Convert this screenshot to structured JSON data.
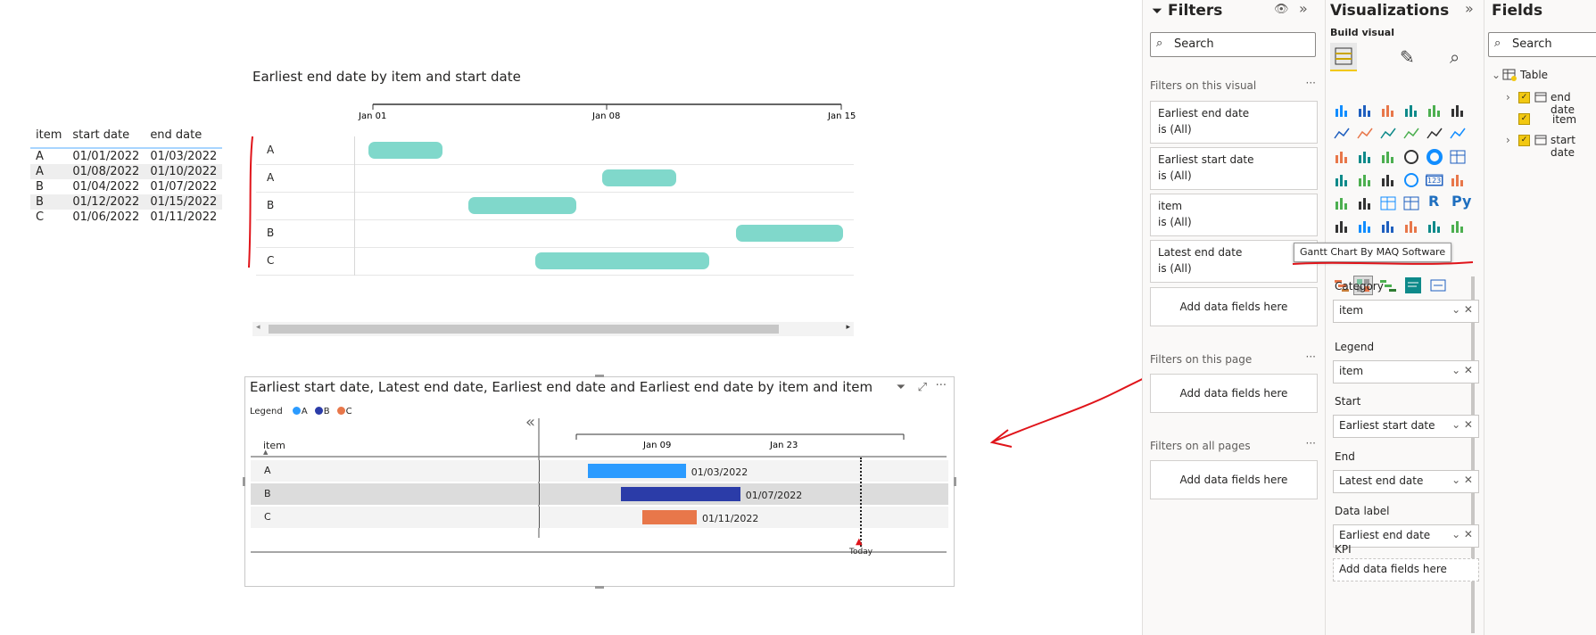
{
  "table": {
    "headers": [
      "item",
      "start date",
      "end date"
    ],
    "rows": [
      [
        "A",
        "01/01/2022",
        "01/03/2022"
      ],
      [
        "A",
        "01/08/2022",
        "01/10/2022"
      ],
      [
        "B",
        "01/04/2022",
        "01/07/2022"
      ],
      [
        "B",
        "01/12/2022",
        "01/15/2022"
      ],
      [
        "C",
        "01/06/2022",
        "01/11/2022"
      ]
    ]
  },
  "gantt1": {
    "title": "Earliest end date by item and start date",
    "ticks": [
      "Jan 01",
      "Jan 08",
      "Jan 15"
    ],
    "rows": [
      {
        "label": "A",
        "start": "2022-01-01",
        "end": "2022-01-03"
      },
      {
        "label": "A",
        "start": "2022-01-08",
        "end": "2022-01-10"
      },
      {
        "label": "B",
        "start": "2022-01-04",
        "end": "2022-01-07"
      },
      {
        "label": "B",
        "start": "2022-01-12",
        "end": "2022-01-15"
      },
      {
        "label": "C",
        "start": "2022-01-06",
        "end": "2022-01-11"
      }
    ],
    "bar_color": "#80D8CB"
  },
  "gantt2": {
    "title": "Earliest start date, Latest end date, Earliest end date and Earliest end date by item and item",
    "legend_title": "Legend",
    "legend": [
      {
        "name": "A",
        "color": "#2B9BFF"
      },
      {
        "name": "B",
        "color": "#2B3CA8"
      },
      {
        "name": "C",
        "color": "#E8774A"
      }
    ],
    "column_header": "item",
    "ticks": [
      "Jan 09",
      "Jan 23"
    ],
    "rows": [
      {
        "label": "A",
        "start": "2022-01-01",
        "end": "2022-01-10",
        "data_label": "01/03/2022",
        "color": "#2B9BFF"
      },
      {
        "label": "B",
        "start": "2022-01-04",
        "end": "2022-01-15",
        "data_label": "01/07/2022",
        "color": "#2B3CA8"
      },
      {
        "label": "C",
        "start": "2022-01-06",
        "end": "2022-01-11",
        "data_label": "01/11/2022",
        "color": "#E8774A"
      }
    ],
    "today_label": "Today",
    "collapse_glyph": "«"
  },
  "filters": {
    "title": "Filters",
    "search_placeholder": "Search",
    "on_visual_label": "Filters on this visual",
    "cards": [
      {
        "title": "Earliest end date",
        "state": "is (All)"
      },
      {
        "title": "Earliest start date",
        "state": "is (All)"
      },
      {
        "title": "item",
        "state": "is (All)"
      },
      {
        "title": "Latest end date",
        "state": "is (All)"
      }
    ],
    "add_fields": "Add data fields here",
    "on_page_label": "Filters on this page",
    "on_all_label": "Filters on all pages"
  },
  "visualizations": {
    "title": "Visualizations",
    "build_visual": "Build visual",
    "tooltip": "Gantt Chart By MAQ Software",
    "wells": [
      {
        "label": "Category",
        "value": "item"
      },
      {
        "label": "Legend",
        "value": "item"
      },
      {
        "label": "Start",
        "value": "Earliest start date"
      },
      {
        "label": "End",
        "value": "Latest end date"
      },
      {
        "label": "Data label",
        "value": "Earliest end date"
      }
    ],
    "kpi_label": "KPI",
    "kpi_placeholder": "Add data fields here",
    "r_glyph": "R",
    "py_glyph": "Py",
    "num_glyph": "123"
  },
  "fields": {
    "title": "Fields",
    "search_placeholder": "Search",
    "table_name": "Table",
    "items": [
      "end date",
      "item",
      "start date"
    ]
  }
}
